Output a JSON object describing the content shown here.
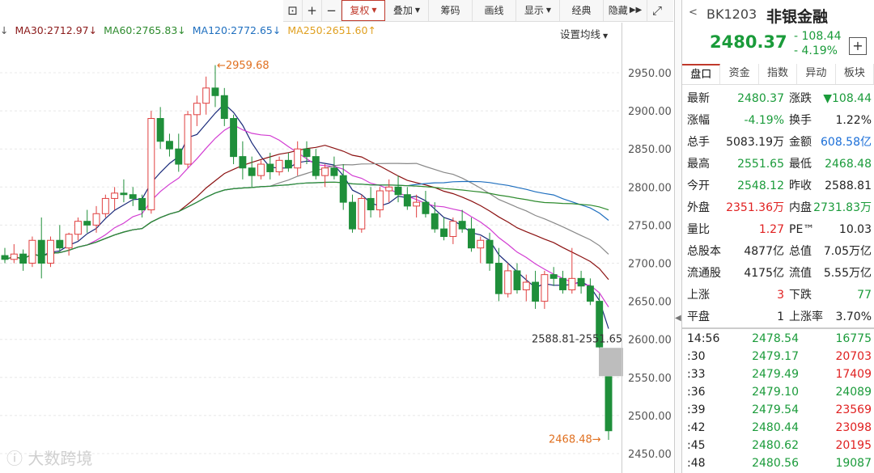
{
  "toolbar": {
    "lock_icon": "lock-icon",
    "plus": "+",
    "minus": "−",
    "fuquan": "复权",
    "diejia": "叠加",
    "chouma": "筹码",
    "huaxian": "画线",
    "xianshi": "显示",
    "jingdian": "经典",
    "yincang": "隐藏",
    "expand_icon": "expand-icon"
  },
  "ma": {
    "ma30": "MA30:2712.97",
    "ma60": "MA60:2765.83",
    "ma120": "MA120:2772.65",
    "ma250": "MA250:2651.60",
    "settings": "设置均线",
    "colors": {
      "ma30": "#8b1a1a",
      "ma60": "#2e8b2e",
      "ma120": "#1f6fbf",
      "ma250": "#e0a020",
      "ma5": "#1a2a7a",
      "ma10": "#d23cd2",
      "ma20": "#8b1010",
      "maX": "#888888"
    }
  },
  "annotations": {
    "high_label": "2959.68",
    "low_label": "2468.48",
    "gap_label": "2588.81-2551.65",
    "watermark": "大数跨境"
  },
  "chart_data": {
    "type": "candlestick",
    "y_ticks": [
      "2950.00",
      "2900.00",
      "2850.00",
      "2800.00",
      "2750.00",
      "2700.00",
      "2650.00",
      "2600.00",
      "2550.00",
      "2500.00",
      "2450.00"
    ],
    "y_tick_values": [
      2950,
      2900,
      2850,
      2800,
      2750,
      2700,
      2650,
      2600,
      2550,
      2500,
      2450
    ],
    "ylim": [
      2430,
      2990
    ],
    "candles": [
      [
        2710,
        2720,
        2700,
        2705
      ],
      [
        2705,
        2725,
        2700,
        2712
      ],
      [
        2712,
        2718,
        2690,
        2700
      ],
      [
        2700,
        2735,
        2695,
        2730
      ],
      [
        2730,
        2760,
        2680,
        2700
      ],
      [
        2700,
        2735,
        2695,
        2730
      ],
      [
        2730,
        2750,
        2715,
        2720
      ],
      [
        2720,
        2740,
        2710,
        2738
      ],
      [
        2738,
        2760,
        2730,
        2755
      ],
      [
        2755,
        2770,
        2740,
        2750
      ],
      [
        2750,
        2775,
        2740,
        2765
      ],
      [
        2765,
        2790,
        2760,
        2785
      ],
      [
        2785,
        2800,
        2770,
        2792
      ],
      [
        2792,
        2810,
        2780,
        2790
      ],
      [
        2790,
        2800,
        2775,
        2785
      ],
      [
        2785,
        2790,
        2760,
        2770
      ],
      [
        2770,
        2900,
        2765,
        2890
      ],
      [
        2890,
        2905,
        2850,
        2860
      ],
      [
        2860,
        2870,
        2840,
        2850
      ],
      [
        2850,
        2870,
        2820,
        2830
      ],
      [
        2830,
        2900,
        2825,
        2895
      ],
      [
        2895,
        2920,
        2880,
        2910
      ],
      [
        2910,
        2945,
        2895,
        2930
      ],
      [
        2930,
        2960,
        2905,
        2920
      ],
      [
        2920,
        2930,
        2880,
        2890
      ],
      [
        2890,
        2895,
        2830,
        2840
      ],
      [
        2840,
        2860,
        2810,
        2825
      ],
      [
        2825,
        2840,
        2800,
        2815
      ],
      [
        2815,
        2835,
        2810,
        2830
      ],
      [
        2830,
        2845,
        2810,
        2820
      ],
      [
        2820,
        2840,
        2815,
        2835
      ],
      [
        2835,
        2845,
        2820,
        2825
      ],
      [
        2825,
        2860,
        2815,
        2850
      ],
      [
        2850,
        2860,
        2830,
        2840
      ],
      [
        2840,
        2850,
        2810,
        2815
      ],
      [
        2815,
        2830,
        2800,
        2825
      ],
      [
        2825,
        2840,
        2810,
        2815
      ],
      [
        2815,
        2830,
        2770,
        2780
      ],
      [
        2780,
        2790,
        2740,
        2745
      ],
      [
        2745,
        2790,
        2740,
        2785
      ],
      [
        2785,
        2800,
        2760,
        2770
      ],
      [
        2770,
        2800,
        2760,
        2795
      ],
      [
        2795,
        2810,
        2780,
        2800
      ],
      [
        2800,
        2815,
        2780,
        2790
      ],
      [
        2790,
        2800,
        2770,
        2775
      ],
      [
        2775,
        2790,
        2760,
        2780
      ],
      [
        2780,
        2795,
        2760,
        2765
      ],
      [
        2765,
        2780,
        2740,
        2745
      ],
      [
        2745,
        2760,
        2730,
        2735
      ],
      [
        2735,
        2760,
        2725,
        2755
      ],
      [
        2755,
        2770,
        2740,
        2745
      ],
      [
        2745,
        2760,
        2715,
        2720
      ],
      [
        2720,
        2735,
        2700,
        2730
      ],
      [
        2730,
        2740,
        2690,
        2700
      ],
      [
        2700,
        2720,
        2650,
        2660
      ],
      [
        2660,
        2700,
        2655,
        2690
      ],
      [
        2690,
        2700,
        2660,
        2665
      ],
      [
        2665,
        2685,
        2650,
        2675
      ],
      [
        2675,
        2690,
        2640,
        2650
      ],
      [
        2650,
        2690,
        2640,
        2685
      ],
      [
        2685,
        2695,
        2670,
        2680
      ],
      [
        2680,
        2690,
        2660,
        2665
      ],
      [
        2665,
        2720,
        2660,
        2680
      ],
      [
        2680,
        2690,
        2660,
        2670
      ],
      [
        2670,
        2680,
        2645,
        2650
      ],
      [
        2650,
        2660,
        2588,
        2590
      ],
      [
        2551,
        2551,
        2468,
        2480
      ]
    ],
    "up_color": "#e04040",
    "down_color": "#1f8f3a"
  },
  "panel": {
    "code": "BK1203",
    "name": "非银金融",
    "price": "2480.37",
    "change": "- 108.44",
    "pct": "- 4.19%",
    "plus_icon": "plus-icon",
    "tabs": [
      "盘口",
      "资金",
      "指数",
      "异动",
      "板块"
    ],
    "stats": [
      [
        "最新",
        "2480.37",
        "g",
        "涨跌",
        "▼108.44",
        "g"
      ],
      [
        "涨幅",
        "-4.19%",
        "g",
        "换手",
        "1.22%",
        "k"
      ],
      [
        "总手",
        "5083.19万",
        "k",
        "金额",
        "608.58亿",
        "b"
      ],
      [
        "最高",
        "2551.65",
        "g",
        "最低",
        "2468.48",
        "g"
      ],
      [
        "今开",
        "2548.12",
        "g",
        "昨收",
        "2588.81",
        "k"
      ],
      [
        "外盘",
        "2351.36万",
        "r",
        "内盘",
        "2731.83万",
        "g"
      ],
      [
        "量比",
        "1.27",
        "r",
        "PE™",
        "10.03",
        "k"
      ],
      [
        "总股本",
        "4877亿",
        "k",
        "总值",
        "7.05万亿",
        "k"
      ],
      [
        "流通股",
        "4175亿",
        "k",
        "流值",
        "5.55万亿",
        "k"
      ],
      [
        "上涨",
        "3",
        "r",
        "下跌",
        "77",
        "g"
      ],
      [
        "平盘",
        "1",
        "k",
        "上涨率",
        "3.70%",
        "k"
      ]
    ],
    "ticks": [
      [
        "14:56",
        "2478.54",
        "16775",
        "g"
      ],
      [
        ":30",
        "2479.17",
        "20703",
        "r"
      ],
      [
        ":33",
        "2479.49",
        "17409",
        "r"
      ],
      [
        ":36",
        "2479.10",
        "24089",
        "g"
      ],
      [
        ":39",
        "2479.54",
        "23569",
        "r"
      ],
      [
        ":42",
        "2480.44",
        "23098",
        "r"
      ],
      [
        ":45",
        "2480.62",
        "20195",
        "r"
      ],
      [
        ":48",
        "2480.56",
        "19087",
        "g"
      ]
    ]
  }
}
